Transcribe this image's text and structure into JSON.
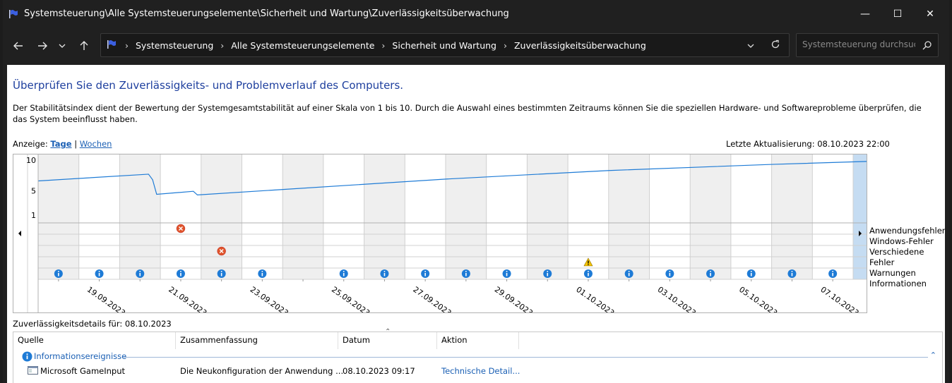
{
  "window": {
    "title": "Systemsteuerung\\Alle Systemsteuerungselemente\\Sicherheit und Wartung\\Zuverlässigkeitsüberwachung",
    "minimize": "—",
    "maximize": "☐",
    "close": "✕"
  },
  "nav": {
    "back": "←",
    "forward": "→",
    "recent": "⌄",
    "up": "↑",
    "breadcrumbs": [
      "Systemsteuerung",
      "Alle Systemsteuerungselemente",
      "Sicherheit und Wartung",
      "Zuverlässigkeitsüberwachung"
    ],
    "breadcrumb_sep": "›",
    "search_placeholder": "Systemsteuerung durchsuchen"
  },
  "page": {
    "heading": "Überprüfen Sie den Zuverlässigkeits- und Problemverlauf des Computers.",
    "description": "Der Stabilitätsindex dient der Bewertung der Systemgesamtstabilität auf einer Skala von 1 bis 10. Durch die Auswahl eines bestimmten Zeitraums können Sie die speziellen Hardware- und Softwareprobleme überprüfen, die das System beeinflusst haben.",
    "view_label": "Anzeige:",
    "view_days": "Tage",
    "view_sep": "|",
    "view_weeks": "Wochen",
    "last_update": "Letzte Aktualisierung: 08.10.2023 22:00"
  },
  "chart_data": {
    "type": "line",
    "ylim": [
      1,
      10
    ],
    "yticks": [
      "10",
      "5",
      "1"
    ],
    "x_labels": [
      "19.09.2023",
      "21.09.2023",
      "23.09.2023",
      "25.09.2023",
      "27.09.2023",
      "29.09.2023",
      "01.10.2023",
      "03.10.2023",
      "05.10.2023",
      "07.10.2023"
    ],
    "days": [
      "18.09",
      "19.09",
      "20.09",
      "21.09",
      "22.09",
      "23.09",
      "24.09",
      "25.09",
      "26.09",
      "27.09",
      "28.09",
      "29.09",
      "30.09",
      "01.10",
      "02.10",
      "03.10",
      "04.10",
      "05.10",
      "06.10",
      "07.10",
      "08.10"
    ],
    "selected_day": "08.10",
    "stability_points": [
      {
        "day": 0,
        "v": 6.6
      },
      {
        "day": 2.7,
        "v": 7.7
      },
      {
        "day": 2.8,
        "v": 6.8
      },
      {
        "day": 2.9,
        "v": 4.4
      },
      {
        "day": 3.8,
        "v": 4.9
      },
      {
        "day": 3.9,
        "v": 4.3
      },
      {
        "day": 6,
        "v": 5.2
      },
      {
        "day": 10,
        "v": 6.9
      },
      {
        "day": 14,
        "v": 8.3
      },
      {
        "day": 18,
        "v": 9.3
      },
      {
        "day": 20.9,
        "v": 9.9
      }
    ],
    "categories": [
      "Anwendungsfehler",
      "Windows-Fehler",
      "Verschiedene Fehler",
      "Warnungen",
      "Informationen"
    ],
    "events": [
      {
        "day": 3,
        "cat": 0,
        "kind": "error"
      },
      {
        "day": 4,
        "cat": 2,
        "kind": "error"
      },
      {
        "day": 13,
        "cat": 3,
        "kind": "warning"
      },
      {
        "day": 0,
        "cat": 4,
        "kind": "info"
      },
      {
        "day": 1,
        "cat": 4,
        "kind": "info"
      },
      {
        "day": 2,
        "cat": 4,
        "kind": "info"
      },
      {
        "day": 3,
        "cat": 4,
        "kind": "info"
      },
      {
        "day": 4,
        "cat": 4,
        "kind": "info"
      },
      {
        "day": 5,
        "cat": 4,
        "kind": "info"
      },
      {
        "day": 7,
        "cat": 4,
        "kind": "info"
      },
      {
        "day": 8,
        "cat": 4,
        "kind": "info"
      },
      {
        "day": 9,
        "cat": 4,
        "kind": "info"
      },
      {
        "day": 10,
        "cat": 4,
        "kind": "info"
      },
      {
        "day": 11,
        "cat": 4,
        "kind": "info"
      },
      {
        "day": 12,
        "cat": 4,
        "kind": "info"
      },
      {
        "day": 13,
        "cat": 4,
        "kind": "info"
      },
      {
        "day": 14,
        "cat": 4,
        "kind": "info"
      },
      {
        "day": 15,
        "cat": 4,
        "kind": "info"
      },
      {
        "day": 16,
        "cat": 4,
        "kind": "info"
      },
      {
        "day": 17,
        "cat": 4,
        "kind": "info"
      },
      {
        "day": 18,
        "cat": 4,
        "kind": "info"
      },
      {
        "day": 19,
        "cat": 4,
        "kind": "info"
      },
      {
        "day": 20,
        "cat": 4,
        "kind": "info"
      }
    ],
    "colors": {
      "line": "#1e7bd6",
      "shade": "#efefef",
      "selected": "#c5dcf2",
      "grid": "#d0d0d0"
    }
  },
  "details": {
    "label": "Zuverlässigkeitsdetails für: 08.10.2023",
    "columns": [
      "Quelle",
      "Zusammenfassung",
      "Datum",
      "Aktion"
    ],
    "group": "Informationsereignisse",
    "rows": [
      {
        "source": "Microsoft GameInput",
        "summary": "Die Neukonfiguration der Anwendung ...",
        "date": "08.10.2023 09:17",
        "action": "Technische Detail..."
      }
    ]
  }
}
